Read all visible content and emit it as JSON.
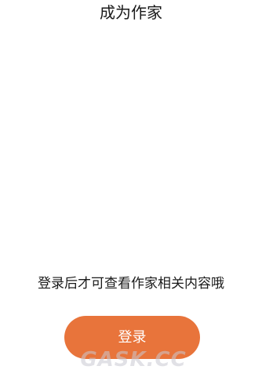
{
  "header": {
    "title": "成为作家"
  },
  "main": {
    "login_hint": "登录后才可查看作家相关内容哦",
    "login_button_label": "登录"
  },
  "watermark": {
    "text": "GASK.CC"
  },
  "colors": {
    "accent": "#e8743b",
    "text": "#1a1a1a",
    "background": "#ffffff"
  }
}
